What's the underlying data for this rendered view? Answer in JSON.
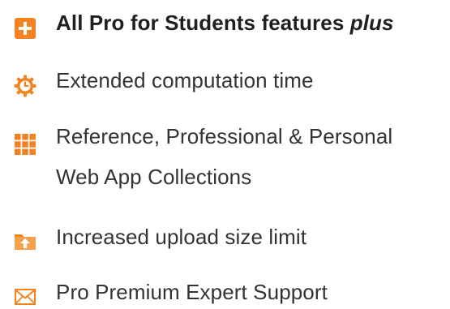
{
  "colors": {
    "accent": "#f58220",
    "text": "#333333"
  },
  "features": [
    {
      "icon": "plus-box-icon",
      "label": "All Pro for Students features ",
      "label_emphasis": "plus"
    },
    {
      "icon": "clock-gear-icon",
      "label": "Extended computation time"
    },
    {
      "icon": "grid-icon",
      "label_line1": "Reference, Professional & Personal",
      "label_line2": "Web App Collections"
    },
    {
      "icon": "folder-upload-icon",
      "label": "Increased upload size limit"
    },
    {
      "icon": "envelope-icon",
      "label": "Pro Premium Expert Support"
    }
  ]
}
